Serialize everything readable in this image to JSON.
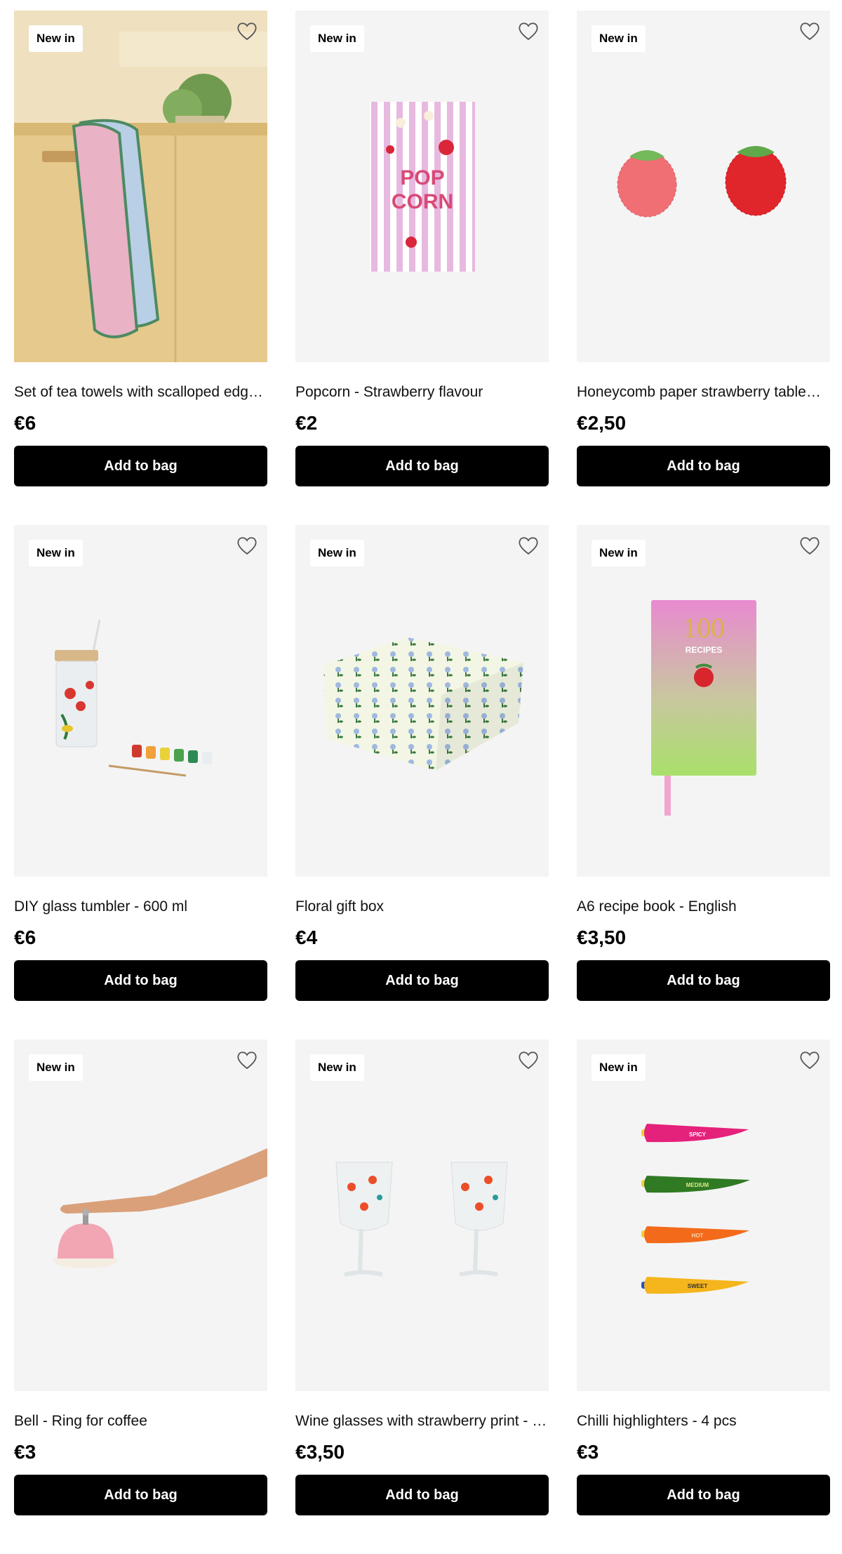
{
  "products": [
    {
      "badge": "New in",
      "title": "Set of tea towels with scalloped edge…",
      "price": "€6",
      "button": "Add to bag",
      "image": "tea-towels-image"
    },
    {
      "badge": "New in",
      "title": "Popcorn - Strawberry flavour",
      "price": "€2",
      "button": "Add to bag",
      "image": "popcorn-bag-image",
      "package_text": "POP CORN"
    },
    {
      "badge": "New in",
      "title": "Honeycomb paper strawberry table…",
      "price": "€2,50",
      "button": "Add to bag",
      "image": "paper-strawberries-image"
    },
    {
      "badge": "New in",
      "title": "DIY glass tumbler - 600 ml",
      "price": "€6",
      "button": "Add to bag",
      "image": "glass-tumbler-image"
    },
    {
      "badge": "New in",
      "title": "Floral gift box",
      "price": "€4",
      "button": "Add to bag",
      "image": "gift-box-image"
    },
    {
      "badge": "New in",
      "title": "A6 recipe book - English",
      "price": "€3,50",
      "button": "Add to bag",
      "image": "recipe-book-image",
      "cover_number": "100",
      "cover_word": "RECIPES"
    },
    {
      "badge": "New in",
      "title": "Bell - Ring for coffee",
      "price": "€3",
      "button": "Add to bag",
      "image": "coffee-bell-image"
    },
    {
      "badge": "New in",
      "title": "Wine glasses with strawberry print - 2…",
      "price": "€3,50",
      "button": "Add to bag",
      "image": "wine-glasses-image"
    },
    {
      "badge": "New in",
      "title": "Chilli highlighters - 4 pcs",
      "price": "€3",
      "button": "Add to bag",
      "image": "chilli-highlighters-image",
      "pen_labels": [
        "SPICY",
        "MEDIUM",
        "HOT",
        "SWEET"
      ]
    }
  ],
  "icons": {
    "favourite": "heart-outline-icon"
  },
  "colors": {
    "card_bg": "#f4f4f4",
    "button_bg": "#000000",
    "button_text": "#ffffff"
  }
}
